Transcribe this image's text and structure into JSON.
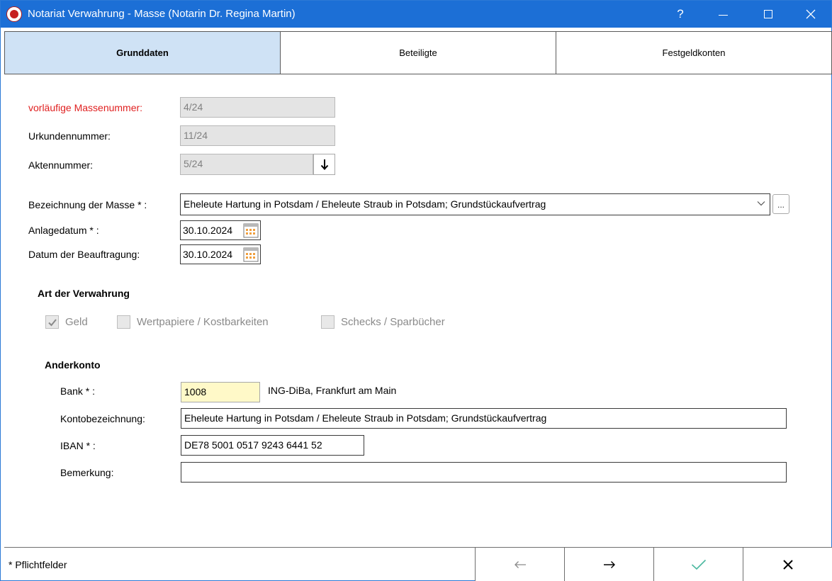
{
  "window": {
    "title": "Notariat Verwahrung - Masse (Notarin Dr. Regina Martin)",
    "help_label": "?"
  },
  "tabs": [
    {
      "label": "Grunddaten",
      "active": true
    },
    {
      "label": "Beteiligte",
      "active": false
    },
    {
      "label": "Festgeldkonten",
      "active": false
    }
  ],
  "form": {
    "massennummer": {
      "label": "vorläufige Massenummer:",
      "value": "4/24"
    },
    "urkundennummer": {
      "label": "Urkundennummer:",
      "value": "11/24"
    },
    "aktennummer": {
      "label": "Aktennummer:",
      "value": "5/24"
    },
    "bezeichnung": {
      "label": "Bezeichnung der Masse * :",
      "value": "Eheleute Hartung in Potsdam / Eheleute Straub in Potsdam; Grundstückaufvertrag",
      "more_label": "..."
    },
    "anlagedatum": {
      "label": "Anlagedatum * :",
      "value": "30.10.2024"
    },
    "beauftragung": {
      "label": "Datum der Beauftragung:",
      "value": "30.10.2024"
    }
  },
  "verwahrung": {
    "title": "Art der Verwahrung",
    "options": [
      {
        "label": "Geld",
        "checked": true
      },
      {
        "label": "Wertpapiere / Kostbarkeiten",
        "checked": false
      },
      {
        "label": "Schecks / Sparbücher",
        "checked": false
      }
    ]
  },
  "anderkonto": {
    "title": "Anderkonto",
    "bank": {
      "label": "Bank * :",
      "value": "1008",
      "name": "ING-DiBa, Frankfurt am Main"
    },
    "kontobezeichnung": {
      "label": "Kontobezeichnung:",
      "value": "Eheleute Hartung in Potsdam / Eheleute Straub in Potsdam; Grundstückaufvertrag"
    },
    "iban": {
      "label": "IBAN * :",
      "value": "DE78 5001 0517 9243 6441 52"
    },
    "bemerkung": {
      "label": "Bemerkung:",
      "value": ""
    }
  },
  "footer": {
    "note": "* Pflichtfelder"
  },
  "colors": {
    "titlebar": "#1c6fd6",
    "active_tab": "#cfe2f5",
    "required_label": "#e02020",
    "bank_field": "#fff9c8",
    "ok_check": "#4bb8a0"
  }
}
